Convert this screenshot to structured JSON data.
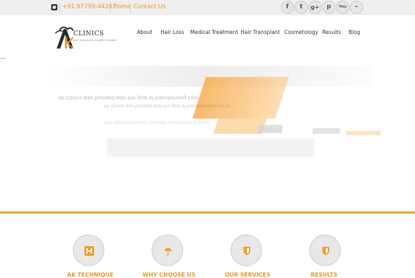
{
  "topbar": {
    "phone": "+91 97799-44207",
    "links": [
      "Home",
      "Contact Us"
    ],
    "social_icons": [
      "facebook-icon",
      "twitter-icon",
      "google-plus-icon",
      "pinterest-icon",
      "youtube-icon",
      "rss-icon"
    ],
    "social_glyphs": [
      "f",
      "t",
      "g+",
      "p",
      "You",
      "⌁"
    ]
  },
  "header": {
    "logo_text": "CLINICS",
    "logo_tag": "HAIR TRANSPLANT & COSMETIC SURGERY",
    "nav": [
      "About",
      "Hair Loss",
      "Medical Treatment",
      "Hair Transplant",
      "Cosmetology",
      "Results",
      "Blog"
    ]
  },
  "hero": {
    "ghost_lines": [
      "AK Clinics was founded with the goal of transforming lives",
      "AK Clinics was founded with the goal of transforming lives in",
      "Hair loss treatments, cosmetic treatments & more"
    ]
  },
  "features": [
    {
      "label": "AK TECHNIQUE",
      "icon": "hospital-icon"
    },
    {
      "label": "WHY CHOOSE US",
      "icon": "umbrella-icon"
    },
    {
      "label": "OUR SERVICES",
      "icon": "shield-icon"
    },
    {
      "label": "RESULTS",
      "icon": "shield-icon"
    }
  ],
  "colors": {
    "accent": "#e8991f",
    "rule": "#f0a01e",
    "topbar_bg": "#efefef"
  }
}
